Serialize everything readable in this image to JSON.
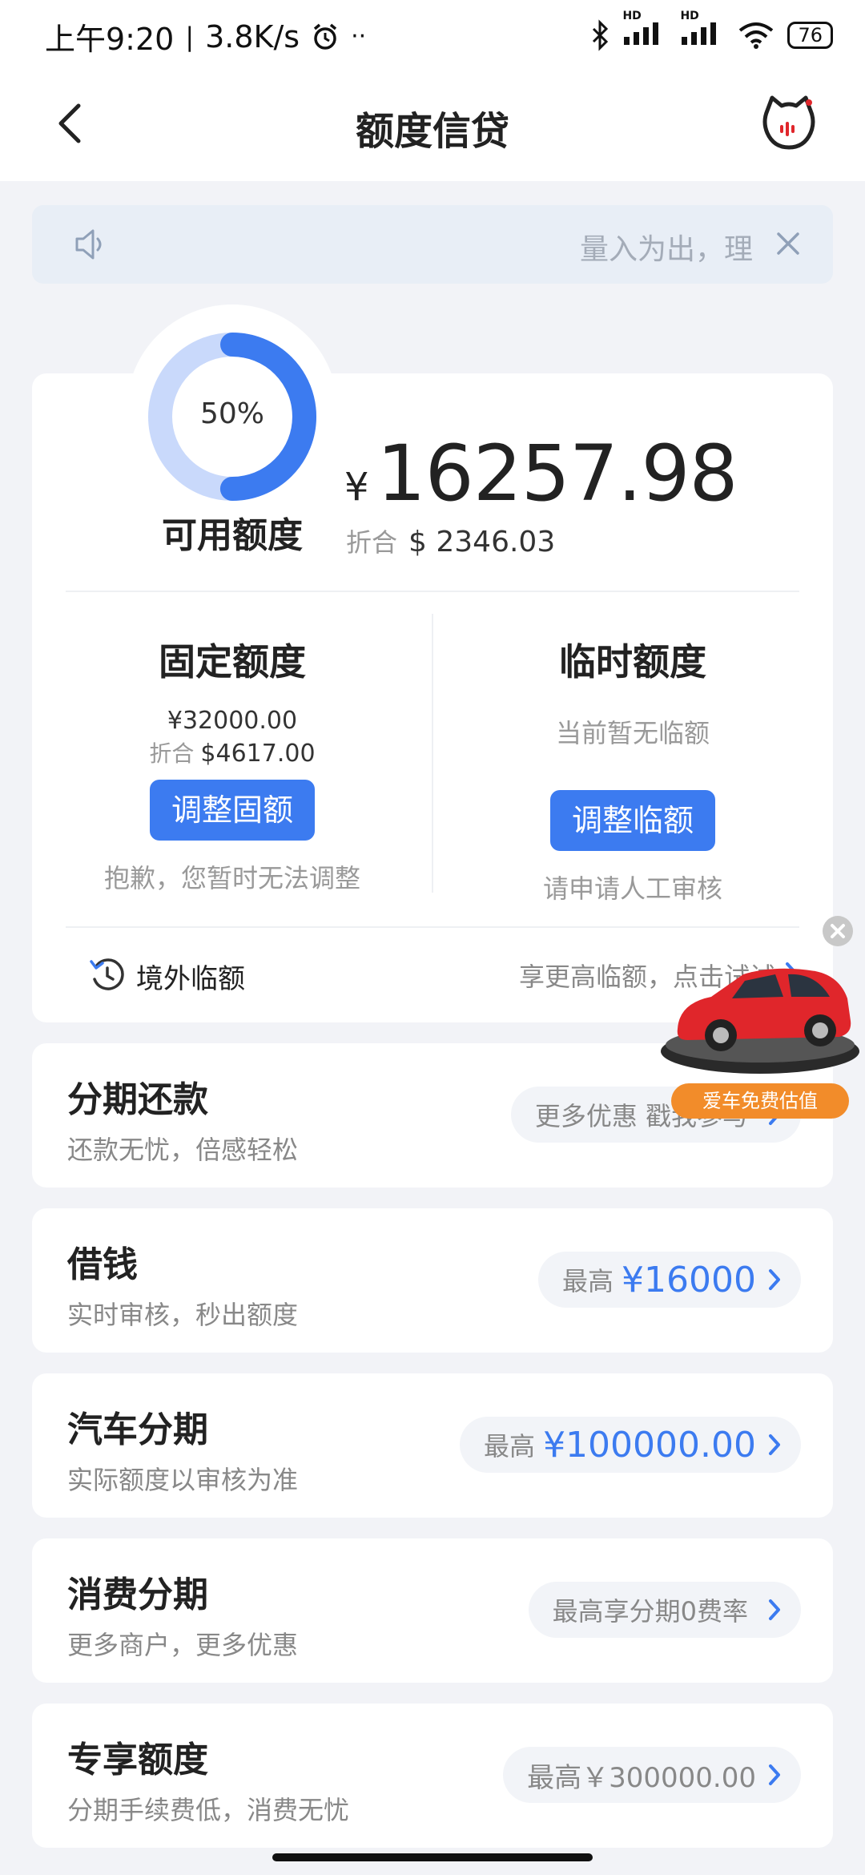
{
  "status_bar": {
    "time": "上午9:20",
    "net_speed": "3.8K/s",
    "battery": "76",
    "hd1": "HD",
    "hd2": "HD"
  },
  "nav": {
    "title": "额度信贷"
  },
  "notice": {
    "text": "量入为出，理"
  },
  "credit": {
    "ring_percent": "50%",
    "ring_fraction": 0.5,
    "available_label": "可用额度",
    "currency": "¥",
    "amount": "16257.98",
    "equiv_label": "折合",
    "equiv_value": "$ 2346.03"
  },
  "fixed_quota": {
    "title": "固定额度",
    "amount": "¥32000.00",
    "equiv_label": "折合",
    "equiv_value": "$4617.00",
    "button": "调整固额",
    "note": "抱歉，您暂时无法调整"
  },
  "temp_quota": {
    "title": "临时额度",
    "status": "当前暂无临额",
    "button": "调整临额",
    "note": "请申请人工审核"
  },
  "overseas": {
    "label": "境外临额",
    "tip": "享更高临额，点击试试"
  },
  "products": [
    {
      "title": "分期还款",
      "subtitle": "还款无忧，倍感轻松",
      "pill_label": "更多优惠 戳我参与",
      "pill_amount": ""
    },
    {
      "title": "借钱",
      "subtitle": "实时审核，秒出额度",
      "pill_label": "最高",
      "pill_amount": "¥16000"
    },
    {
      "title": "汽车分期",
      "subtitle": "实际额度以审核为准",
      "pill_label": "最高",
      "pill_amount": "¥100000.00"
    },
    {
      "title": "消费分期",
      "subtitle": "更多商户，更多优惠",
      "pill_label": "最高享分期0费率",
      "pill_amount": ""
    },
    {
      "title": "专享额度",
      "subtitle": "分期手续费低，消费无忧",
      "pill_label": "",
      "pill_amount": "最高￥300000.00"
    }
  ],
  "float_ad": {
    "label": "爱车免费估值"
  },
  "colors": {
    "accent": "#3c7bf0",
    "ring_light": "#c9d9fb",
    "ad_orange": "#f28c2a",
    "car_red": "#e0262b"
  }
}
